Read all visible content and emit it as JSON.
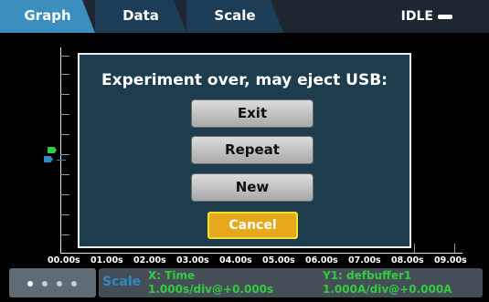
{
  "tabs": [
    {
      "label": "Graph",
      "active": true
    },
    {
      "label": "Data",
      "active": false
    },
    {
      "label": "Scale",
      "active": false
    }
  ],
  "status": "IDLE",
  "graph": {
    "x_ticks": [
      "00.00s",
      "01.00s",
      "02.00s",
      "03.00s",
      "04.00s",
      "05.00s",
      "06.00s",
      "07.00s",
      "08.00s",
      "09.00s"
    ]
  },
  "dialog": {
    "title": "Experiment over, may eject USB:",
    "buttons": {
      "exit": "Exit",
      "repeat": "Repeat",
      "new": "New",
      "cancel": "Cancel"
    }
  },
  "bottom": {
    "scale_label": "Scale",
    "x_title": "X: Time",
    "x_scale": "1.000s/div@+0.000s",
    "y1_title": "Y1: defbuffer1",
    "y1_scale": "1.000A/div@+0.000A"
  },
  "colors": {
    "accent": "#3a8fbe",
    "trace_green": "#2fcd41",
    "trace_blue": "#2e89c4",
    "cancel": "#e6a81c"
  },
  "icons": {
    "status": "idle-bar-icon",
    "pager": "page-dots-icon"
  }
}
